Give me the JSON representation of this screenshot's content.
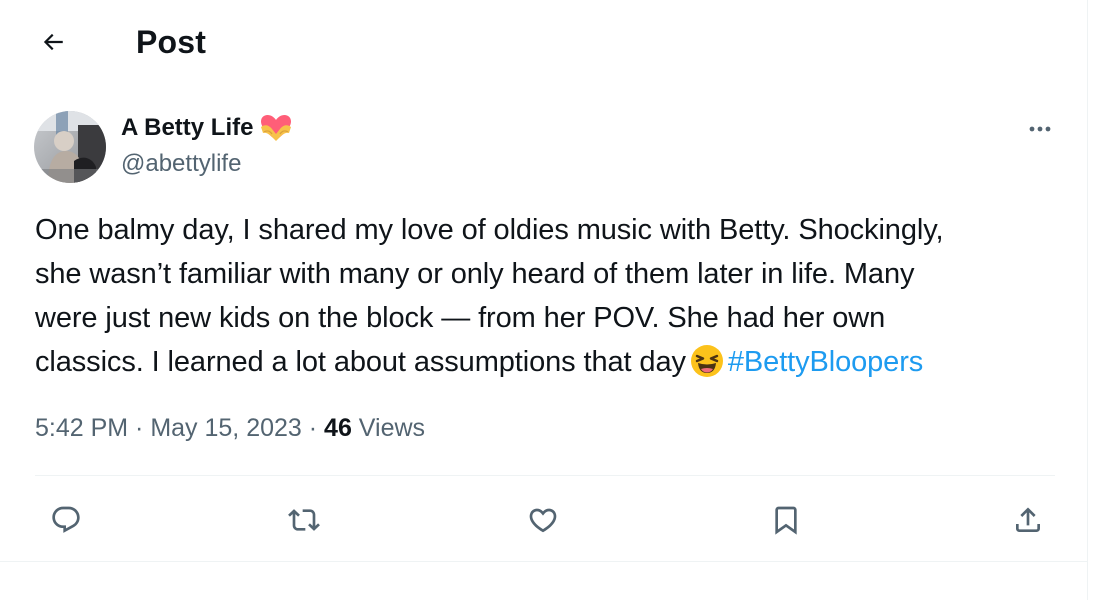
{
  "header": {
    "back_icon": "arrow-left-icon",
    "title": "Post"
  },
  "author": {
    "name": "A Betty Life",
    "handle": "@abettylife",
    "badge_icon": "heart-hands-emoji-icon",
    "avatar_alt": "profile photo"
  },
  "tweet": {
    "lines": [
      "One balmy day, I shared my love of oldies music with Betty. Shockingly,",
      "she wasn’t familiar with many or only heard of them later in life. Many",
      "were just new kids on the block — from her POV. She had her own",
      "classics. I learned a lot about assumptions that day"
    ],
    "emoji_icon": "laughing-face-emoji-icon",
    "hashtag": "#BettyBloopers"
  },
  "meta": {
    "time": "5:42 PM",
    "sep1": " · ",
    "date": "May 15, 2023",
    "sep2": " · ",
    "views_count": "46",
    "views_label": " Views"
  },
  "actions": {
    "reply_icon": "reply-icon",
    "repost_icon": "repost-icon",
    "like_icon": "heart-icon",
    "bookmark_icon": "bookmark-icon",
    "share_icon": "share-icon",
    "more_icon": "more-horizontal-icon"
  },
  "colors": {
    "text": "#0f1419",
    "secondary": "#536471",
    "link": "#1d9bf0",
    "divider": "#eff3f4"
  }
}
